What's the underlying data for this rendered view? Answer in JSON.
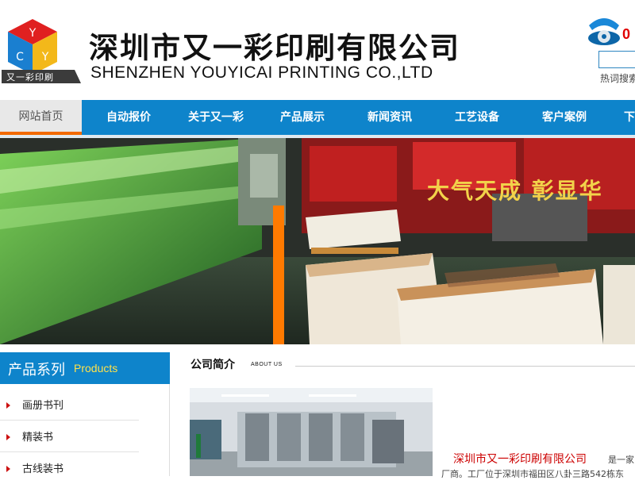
{
  "header": {
    "logo_letters": [
      "Y",
      "C",
      "Y"
    ],
    "logo_tagline": "又一彩印刷",
    "company_cn": "深圳市又一彩印刷有限公司",
    "company_en": "SHENZHEN YOUYICAI PRINTING CO.,LTD",
    "phone_partial": "0",
    "search_placeholder": "",
    "hot_search_label": "热词搜索"
  },
  "nav": {
    "items": [
      {
        "label": "网站首页",
        "active": true
      },
      {
        "label": "自动报价"
      },
      {
        "label": "关于又一彩"
      },
      {
        "label": "产品展示"
      },
      {
        "label": "新闻资讯"
      },
      {
        "label": "工艺设备"
      },
      {
        "label": "客户案例"
      },
      {
        "label": "下"
      }
    ]
  },
  "banner": {
    "slogan": "大气天成 彰显华"
  },
  "sidebar": {
    "title_cn": "产品系列",
    "title_en": "Products",
    "items": [
      {
        "label": "画册书刊"
      },
      {
        "label": "精装书"
      },
      {
        "label": "古线装书"
      }
    ]
  },
  "about": {
    "title": "公司简介",
    "subtitle": "ABOUT US",
    "company_name": "深圳市又一彩印刷有限公司",
    "text_line1": "是一家",
    "text_line2": "厂商。工厂位于深圳市福田区八卦三路542栋东"
  },
  "colors": {
    "nav_blue": "#0e84cb",
    "active_underline": "#f26a00",
    "accent_red": "#cc0000",
    "products_en": "#ffe14a"
  }
}
